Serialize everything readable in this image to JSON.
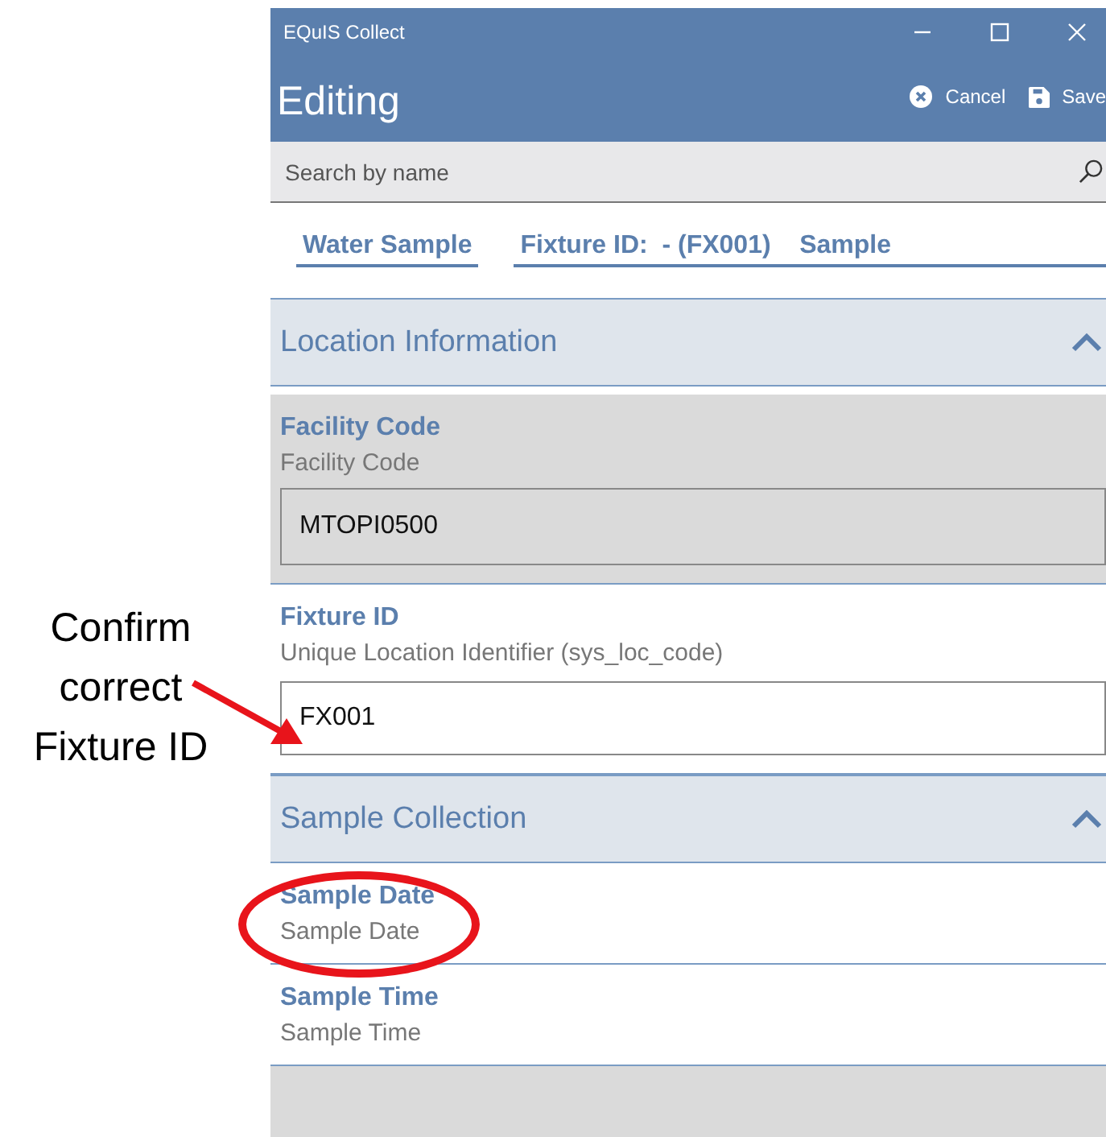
{
  "callout": {
    "text": "Confirm correct Fixture ID"
  },
  "window": {
    "title": "EQuIS Collect"
  },
  "header": {
    "title": "Editing",
    "actions": [
      {
        "label": "Cancel",
        "kind": "cancel"
      },
      {
        "label": "Save",
        "kind": "save"
      }
    ]
  },
  "search": {
    "placeholder": "Search by name"
  },
  "breadcrumbs": [
    "Water Sample",
    "Fixture ID:  - (FX001)    Sample"
  ],
  "sections": [
    {
      "title": "Location Information",
      "expanded": true,
      "fields": [
        {
          "label": "Facility Code",
          "hint": "Facility Code",
          "value": "MTOPI0500",
          "disabled": true
        },
        {
          "label": "Fixture ID",
          "hint": "Unique Location Identifier (sys_loc_code)",
          "value": "FX001",
          "disabled": false
        }
      ]
    },
    {
      "title": "Sample Collection",
      "expanded": true,
      "fields": [
        {
          "label": "Sample Date",
          "hint": "Sample Date",
          "disabled": false,
          "circled": true
        },
        {
          "label": "Sample Time",
          "hint": "Sample Time",
          "disabled": false
        }
      ]
    }
  ]
}
